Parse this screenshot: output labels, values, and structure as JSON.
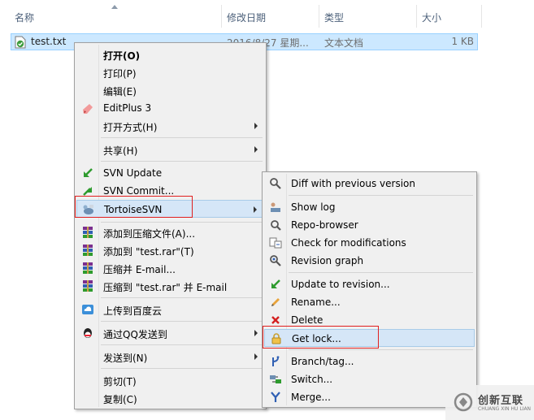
{
  "header": {
    "col_name": "名称",
    "col_date": "修改日期",
    "col_type": "类型",
    "col_size": "大小"
  },
  "file": {
    "name": "test.txt",
    "date": "2016/8/27 星期...",
    "type": "文本文档",
    "size": "1 KB"
  },
  "context_menu": {
    "items": [
      {
        "label": "打开(O)",
        "icon": "none",
        "bold": true
      },
      {
        "label": "打印(P)",
        "icon": "none"
      },
      {
        "label": "编辑(E)",
        "icon": "none"
      },
      {
        "label": "EditPlus 3",
        "icon": "editplus-icon"
      },
      {
        "label": "打开方式(H)",
        "icon": "none",
        "submenu": true
      },
      {
        "label": "共享(H)",
        "icon": "none",
        "submenu": true
      },
      {
        "label": "SVN Update",
        "icon": "svn-update-icon"
      },
      {
        "label": "SVN Commit...",
        "icon": "svn-commit-icon"
      },
      {
        "label": "TortoiseSVN",
        "icon": "tortoisesvn-icon",
        "submenu": true,
        "highlighted": true
      },
      {
        "label": "添加到压缩文件(A)...",
        "icon": "winrar-icon"
      },
      {
        "label": "添加到 \"test.rar\"(T)",
        "icon": "winrar-icon"
      },
      {
        "label": "压缩并 E-mail...",
        "icon": "winrar-icon"
      },
      {
        "label": "压缩到 \"test.rar\" 并 E-mail",
        "icon": "winrar-icon"
      },
      {
        "label": "上传到百度云",
        "icon": "baidu-cloud-icon"
      },
      {
        "label": "通过QQ发送到",
        "icon": "qq-icon",
        "submenu": true
      },
      {
        "label": "发送到(N)",
        "icon": "none",
        "submenu": true
      },
      {
        "label": "剪切(T)",
        "icon": "none"
      },
      {
        "label": "复制(C)",
        "icon": "none"
      }
    ]
  },
  "svn_submenu": {
    "items": [
      {
        "label": "Diff with previous version",
        "icon": "diff-icon"
      },
      {
        "label": "Show log",
        "icon": "show-log-icon"
      },
      {
        "label": "Repo-browser",
        "icon": "repo-browser-icon"
      },
      {
        "label": "Check for modifications",
        "icon": "check-modifications-icon"
      },
      {
        "label": "Revision graph",
        "icon": "revision-graph-icon"
      },
      {
        "label": "Update to revision...",
        "icon": "update-revision-icon"
      },
      {
        "label": "Rename...",
        "icon": "rename-icon"
      },
      {
        "label": "Delete",
        "icon": "delete-icon"
      },
      {
        "label": "Get lock...",
        "icon": "lock-icon",
        "highlighted": true
      },
      {
        "label": "Branch/tag...",
        "icon": "branch-icon"
      },
      {
        "label": "Switch...",
        "icon": "switch-icon"
      },
      {
        "label": "Merge...",
        "icon": "merge-icon"
      }
    ]
  },
  "watermark": {
    "text": "创新互联",
    "sub": "CHUANG XIN HU LIAN"
  }
}
